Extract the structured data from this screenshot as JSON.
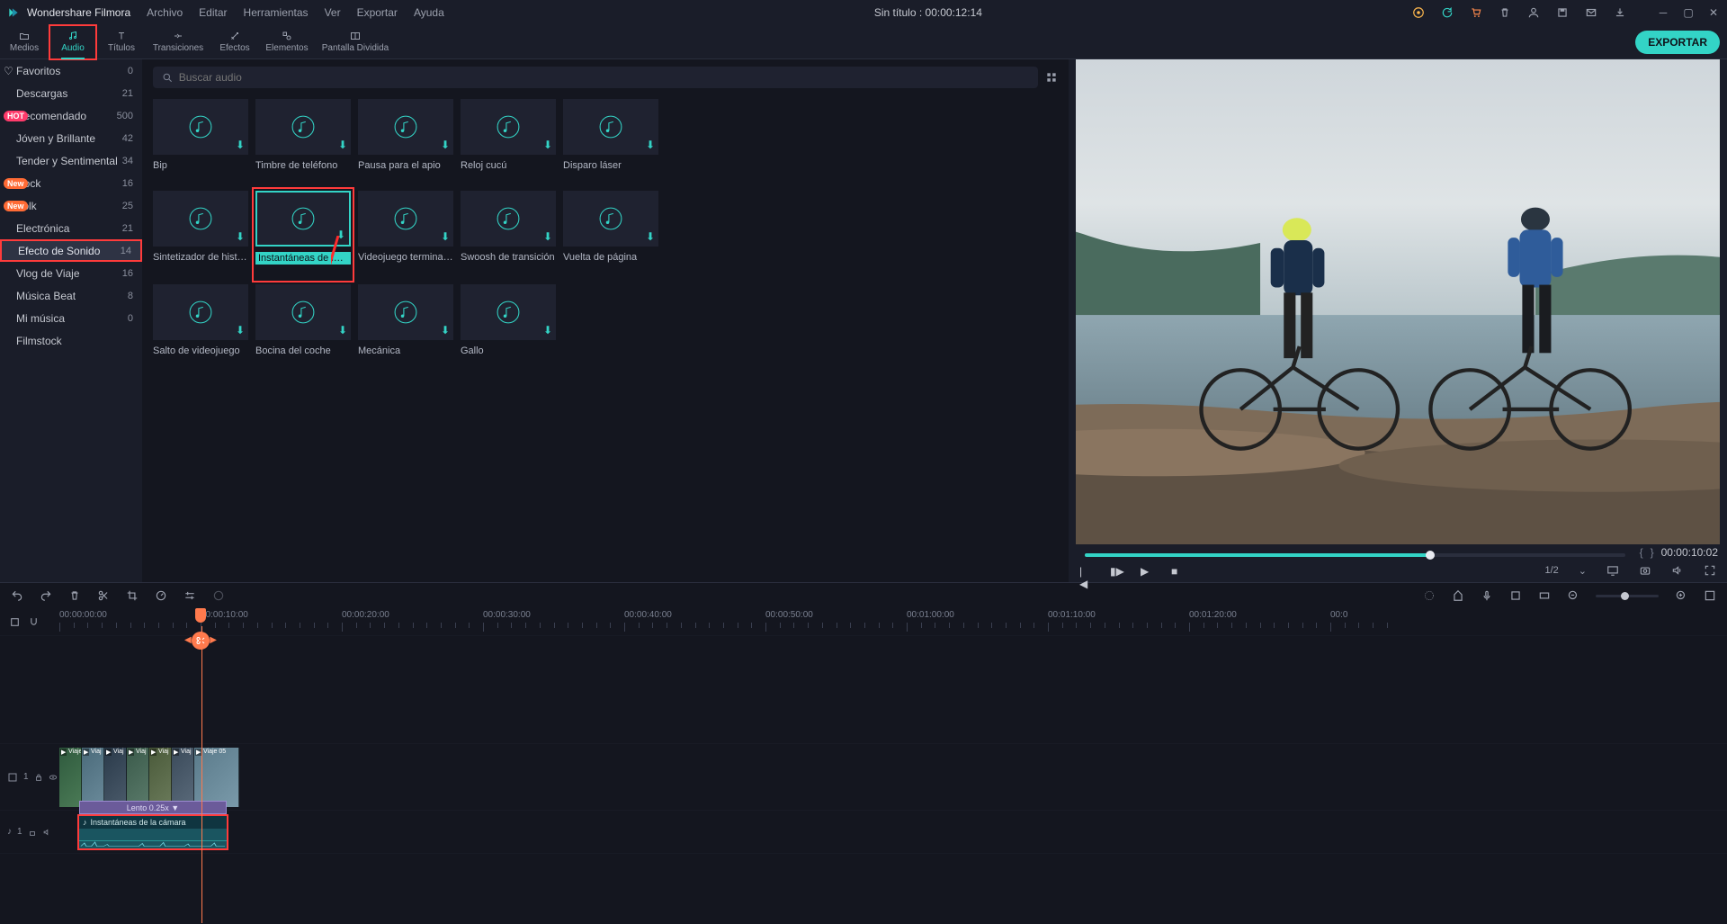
{
  "app_name": "Wondershare Filmora",
  "menu": [
    "Archivo",
    "Editar",
    "Herramientas",
    "Ver",
    "Exportar",
    "Ayuda"
  ],
  "title_center": "Sin título : 00:00:12:14",
  "main_tabs": [
    {
      "label": "Medios"
    },
    {
      "label": "Audio"
    },
    {
      "label": "Títulos"
    },
    {
      "label": "Transiciones"
    },
    {
      "label": "Efectos"
    },
    {
      "label": "Elementos"
    },
    {
      "label": "Pantalla Dividida"
    }
  ],
  "export_label": "EXPORTAR",
  "sidebar": {
    "items": [
      {
        "label": "Favoritos",
        "count": "0",
        "heart": true
      },
      {
        "label": "Descargas",
        "count": "21"
      },
      {
        "label": "Recomendado",
        "count": "500",
        "badge": "HOT"
      },
      {
        "label": "Jóven y Brillante",
        "count": "42"
      },
      {
        "label": "Tender y Sentimental",
        "count": "34"
      },
      {
        "label": "Rock",
        "count": "16",
        "badge": "New"
      },
      {
        "label": "Folk",
        "count": "25",
        "badge": "New"
      },
      {
        "label": "Electrónica",
        "count": "21"
      },
      {
        "label": "Efecto de Sonido",
        "count": "14"
      },
      {
        "label": "Vlog de Viaje",
        "count": "16"
      },
      {
        "label": "Música Beat",
        "count": "8"
      },
      {
        "label": "Mi música",
        "count": "0"
      },
      {
        "label": "Filmstock",
        "count": ""
      }
    ]
  },
  "search": {
    "placeholder": "Buscar audio"
  },
  "assets": [
    {
      "label": "Bip"
    },
    {
      "label": "Timbre de teléfono"
    },
    {
      "label": "Pausa para el apio"
    },
    {
      "label": "Reloj cucú"
    },
    {
      "label": "Disparo láser"
    },
    {
      "label": "Sintetizador de histor…"
    },
    {
      "label": "Instantáneas de la cá…"
    },
    {
      "label": "Videojuego terminado"
    },
    {
      "label": "Swoosh de transición"
    },
    {
      "label": "Vuelta de página"
    },
    {
      "label": "Salto de videojuego"
    },
    {
      "label": "Bocina del coche"
    },
    {
      "label": "Mecánica"
    },
    {
      "label": "Gallo"
    }
  ],
  "preview": {
    "page_indicator": "1/2",
    "timecode_end": "00:00:10:02",
    "progress_pct": 64
  },
  "timeline": {
    "ruler": [
      "00:00:00:00",
      "00:00:10:00",
      "00:00:20:00",
      "00:00:30:00",
      "00:00:40:00",
      "00:00:50:00",
      "00:01:00:00",
      "00:01:10:00",
      "00:01:20:00",
      "00:0"
    ],
    "speed_badge": "Lento 0.25x ▼",
    "audio_clip_label": "Instantáneas de la cámara",
    "clips": [
      {
        "label": "Viaje"
      },
      {
        "label": "Viaj"
      },
      {
        "label": "Viaj"
      },
      {
        "label": "Viaj"
      },
      {
        "label": "Viaj"
      },
      {
        "label": "Viaj"
      },
      {
        "label": "Viaje 05"
      }
    ],
    "track1_label": "1",
    "audio_track_label": "1"
  }
}
